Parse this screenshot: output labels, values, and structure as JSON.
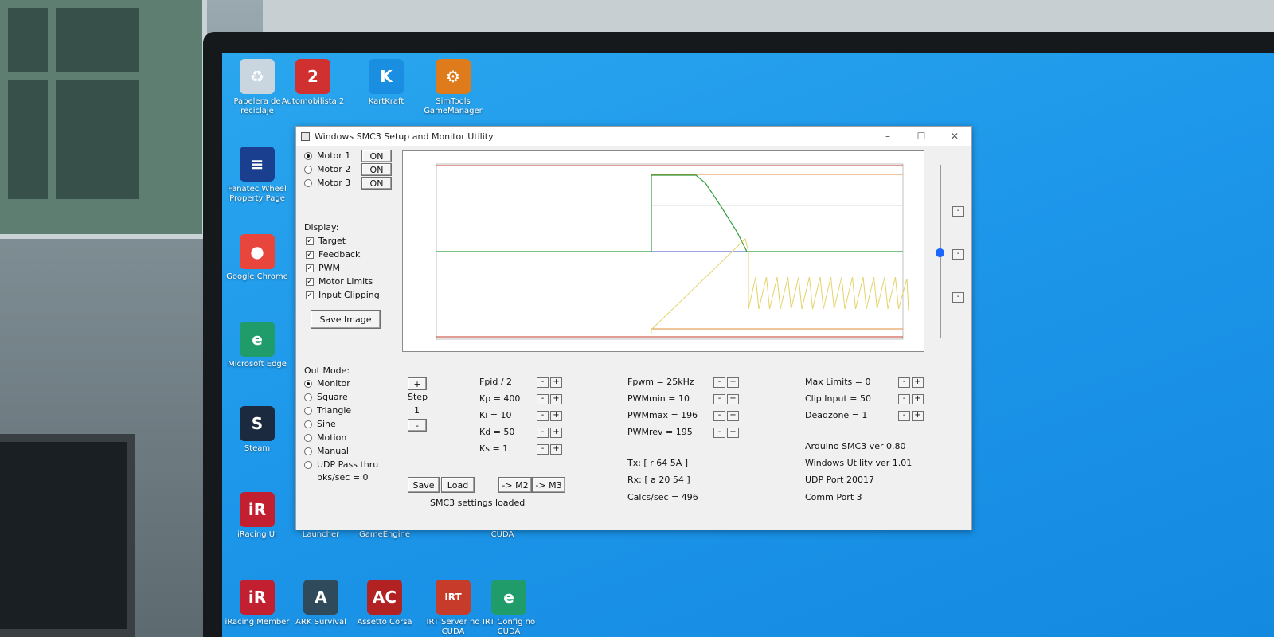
{
  "desktop_icons": [
    {
      "id": "recycle",
      "label": "Papelera de reciclaje",
      "glyph": "♻",
      "color": "#c9d6e0"
    },
    {
      "id": "ams2",
      "label": "Automobilista 2",
      "glyph": "2",
      "color": "#d03030"
    },
    {
      "id": "kartkraft",
      "label": "KartKraft",
      "glyph": "K",
      "color": "#1a8ee0"
    },
    {
      "id": "simtools",
      "label": "SimTools GameManager",
      "glyph": "⚙",
      "color": "#e07b1c"
    },
    {
      "id": "fanatec",
      "label": "Fanatec Wheel Property Page",
      "glyph": "≡",
      "color": "#1a3f8f"
    },
    {
      "id": "chrome",
      "label": "Google Chrome",
      "glyph": "●",
      "color": "#e8453c"
    },
    {
      "id": "edge",
      "label": "Microsoft Edge",
      "glyph": "e",
      "color": "#1f9c6a"
    },
    {
      "id": "steam",
      "label": "Steam",
      "glyph": "S",
      "color": "#1b2a3f"
    },
    {
      "id": "iracing-ui",
      "label": "iRacing UI",
      "glyph": "iR",
      "color": "#c21f30"
    },
    {
      "id": "launcher",
      "label": "Launcher",
      "glyph": "",
      "color": "#1d8fe6"
    },
    {
      "id": "gameengine",
      "label": "GameEngine",
      "glyph": "",
      "color": "#1d8fe6"
    },
    {
      "id": "cuda1",
      "label": "CUDA",
      "glyph": "",
      "color": "#1d8fe6"
    },
    {
      "id": "iracing-member",
      "label": "iRacing Member",
      "glyph": "iR",
      "color": "#c21f30"
    },
    {
      "id": "ark",
      "label": "ARK Survival",
      "glyph": "A",
      "color": "#2f4b5b"
    },
    {
      "id": "assetto",
      "label": "Assetto Corsa",
      "glyph": "AC",
      "color": "#b22222"
    },
    {
      "id": "irt-server",
      "label": "IRT Server no CUDA",
      "glyph": "IRT",
      "color": "#c73b2a"
    },
    {
      "id": "irt-config",
      "label": "IRT Config no CUDA",
      "glyph": "e",
      "color": "#1f9c6a"
    }
  ],
  "window": {
    "title": "Windows SMC3 Setup and Monitor Utility",
    "controls": {
      "minimize": "–",
      "maximize": "☐",
      "close": "✕"
    }
  },
  "motors": [
    {
      "label": "Motor 1",
      "state": "ON",
      "selected": true
    },
    {
      "label": "Motor 2",
      "state": "ON",
      "selected": false
    },
    {
      "label": "Motor 3",
      "state": "ON",
      "selected": false
    }
  ],
  "display": {
    "heading": "Display:",
    "options": [
      {
        "label": "Target",
        "checked": true
      },
      {
        "label": "Feedback",
        "checked": true
      },
      {
        "label": "PWM",
        "checked": true
      },
      {
        "label": "Motor Limits",
        "checked": true
      },
      {
        "label": "Input Clipping",
        "checked": true
      }
    ],
    "save_image": "Save Image"
  },
  "out_mode": {
    "heading": "Out Mode:",
    "options": [
      {
        "label": "Monitor",
        "selected": true
      },
      {
        "label": "Square",
        "selected": false
      },
      {
        "label": "Triangle",
        "selected": false
      },
      {
        "label": "Sine",
        "selected": false
      },
      {
        "label": "Motion",
        "selected": false
      },
      {
        "label": "Manual",
        "selected": false
      },
      {
        "label": "UDP Pass thru",
        "selected": false
      }
    ],
    "pks": "pks/sec = 0"
  },
  "step": {
    "plus": "+",
    "label": "Step",
    "value": "1",
    "minus": "-"
  },
  "pid": [
    {
      "text": "Fpid / 2"
    },
    {
      "text": "Kp = 400"
    },
    {
      "text": "Ki = 10"
    },
    {
      "text": "Kd = 50"
    },
    {
      "text": "Ks = 1"
    }
  ],
  "pwm": [
    {
      "text": "Fpwm = 25kHz"
    },
    {
      "text": "PWMmin = 10"
    },
    {
      "text": "PWMmax = 196"
    },
    {
      "text": "PWMrev = 195"
    }
  ],
  "limits": [
    {
      "text": "Max Limits = 0"
    },
    {
      "text": "Clip Input = 50"
    },
    {
      "text": "Deadzone = 1"
    }
  ],
  "info": {
    "arduino": "Arduino SMC3 ver 0.80",
    "utility": "Windows Utility ver 1.01",
    "udp": "UDP Port 20017",
    "comm": "Comm Port 3",
    "tx": "Tx: [ r 64 5A ]",
    "rx": "Rx: [ a 20 54 ]",
    "calcs": "Calcs/sec = 496"
  },
  "buttons": {
    "save": "Save",
    "load": "Load",
    "m2": "-> M2",
    "m3": "-> M3",
    "minus": "-",
    "plus": "+"
  },
  "status": "SMC3 settings loaded",
  "colors": {
    "limit": "#c0392b",
    "target": "#2e9e3e",
    "feedback": "#3a4fc0",
    "pwm": "#e3d36a",
    "clip": "#e08a3a"
  }
}
